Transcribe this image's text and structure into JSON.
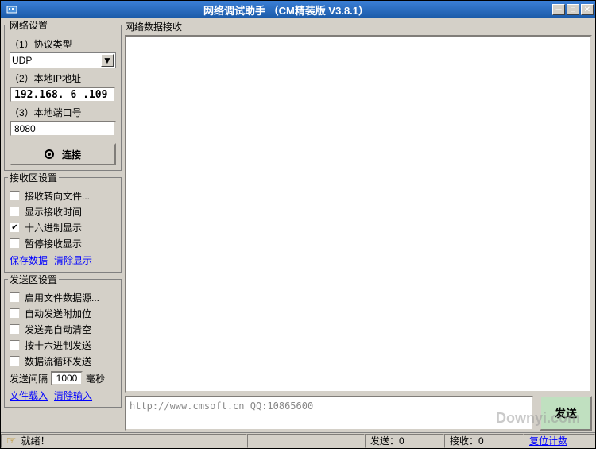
{
  "window": {
    "title": "网络调试助手 （CM精装版 V3.8.1）"
  },
  "network": {
    "group_title": "网络设置",
    "protocol_label": "（1）协议类型",
    "protocol_value": "UDP",
    "ip_label": "（2）本地IP地址",
    "ip_value": "192.168. 6 .109",
    "port_label": "（3）本地端口号",
    "port_value": "8080",
    "connect_label": "连接"
  },
  "recv_settings": {
    "group_title": "接收区设置",
    "opt_file": "接收转向文件...",
    "opt_time": "显示接收时间",
    "opt_hex": "十六进制显示",
    "opt_pause": "暂停接收显示",
    "save_link": "保存数据",
    "clear_link": "清除显示"
  },
  "send_settings": {
    "group_title": "发送区设置",
    "opt_file_src": "启用文件数据源...",
    "opt_auto_extra": "自动发送附加位",
    "opt_auto_clear": "发送完自动清空",
    "opt_hex_send": "按十六进制发送",
    "opt_loop": "数据流循环发送",
    "interval_label": "发送间隔",
    "interval_value": "1000",
    "interval_unit": "毫秒",
    "file_link": "文件载入",
    "clear_link": "清除输入"
  },
  "recv_area": {
    "label": "网络数据接收"
  },
  "send_area": {
    "input_value": "http://www.cmsoft.cn QQ:10865600",
    "send_button": "发送"
  },
  "status": {
    "ready": "就绪！",
    "send": "发送：0",
    "recv": "接收：0",
    "reset": "复位计数"
  },
  "watermark": "Downyi.com"
}
